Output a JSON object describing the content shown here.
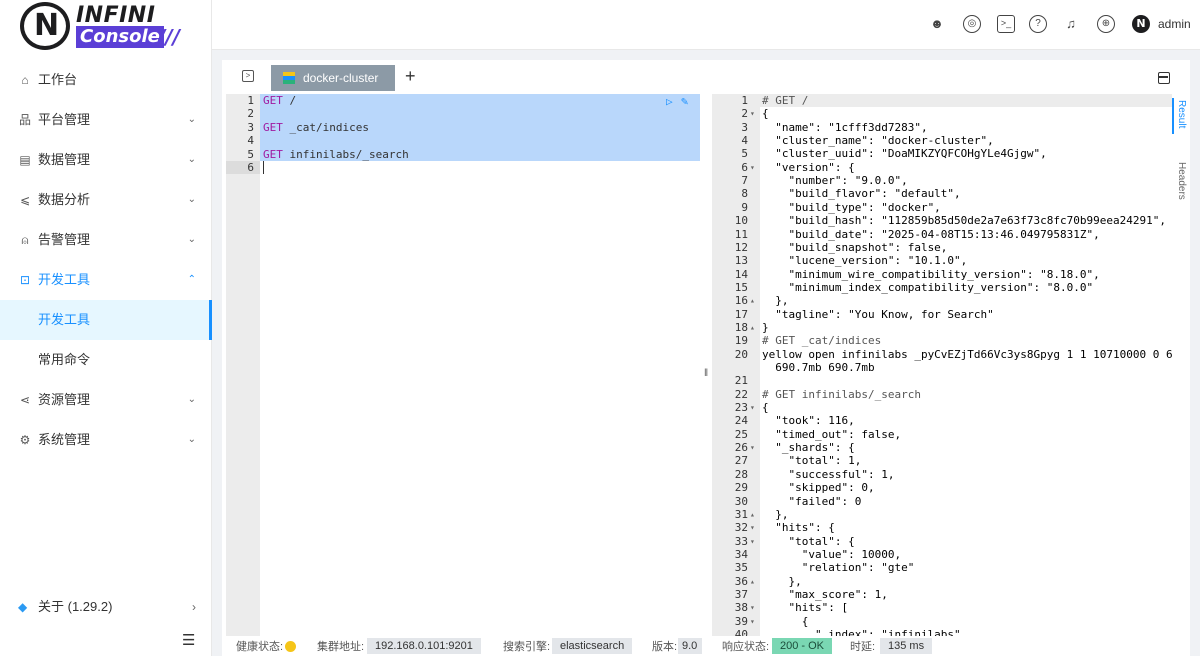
{
  "brand": {
    "mark": "N",
    "name_top": "INFINI",
    "name_bottom": "Console",
    "slashes": "///"
  },
  "colors": {
    "accent": "#1890ff",
    "brand_purple": "#5b3fd6",
    "selection": "#b9d7fb",
    "ok_chip": "#7ad7b3",
    "health_yellow": "#f5c518"
  },
  "sidebar": {
    "items": [
      {
        "label": "工作台",
        "icon": "home-icon"
      },
      {
        "label": "平台管理",
        "icon": "cluster-icon"
      },
      {
        "label": "数据管理",
        "icon": "database-icon"
      },
      {
        "label": "数据分析",
        "icon": "chart-icon"
      },
      {
        "label": "告警管理",
        "icon": "alarm-icon"
      },
      {
        "label": "开发工具",
        "icon": "terminal-icon"
      },
      {
        "label": "开发工具"
      },
      {
        "label": "常用命令"
      },
      {
        "label": "资源管理",
        "icon": "share-icon"
      },
      {
        "label": "系统管理",
        "icon": "gear-icon"
      }
    ],
    "about": "关于 (1.29.2)"
  },
  "topbar": {
    "user": "admin"
  },
  "tabs": [
    {
      "label": "docker-cluster"
    }
  ],
  "editor": {
    "lines": [
      {
        "no": "1",
        "method": "GET",
        "path": " /"
      },
      {
        "no": "2",
        "method": "",
        "path": ""
      },
      {
        "no": "3",
        "method": "GET",
        "path": " _cat/indices"
      },
      {
        "no": "4",
        "method": "",
        "path": ""
      },
      {
        "no": "5",
        "method": "GET",
        "path": " infinilabs/_search"
      },
      {
        "no": "6",
        "method": "",
        "path": ""
      }
    ]
  },
  "output": {
    "lines": [
      {
        "no": "1",
        "text": "# GET /"
      },
      {
        "no": "2",
        "text": "{"
      },
      {
        "no": "3",
        "text": "  \"name\": \"1cfff3dd7283\","
      },
      {
        "no": "4",
        "text": "  \"cluster_name\": \"docker-cluster\","
      },
      {
        "no": "5",
        "text": "  \"cluster_uuid\": \"DoaMIKZYQFCOHgYLe4Gjgw\","
      },
      {
        "no": "6",
        "text": "  \"version\": {"
      },
      {
        "no": "7",
        "text": "    \"number\": \"9.0.0\","
      },
      {
        "no": "8",
        "text": "    \"build_flavor\": \"default\","
      },
      {
        "no": "9",
        "text": "    \"build_type\": \"docker\","
      },
      {
        "no": "10",
        "text": "    \"build_hash\": \"112859b85d50de2a7e63f73c8fc70b99eea24291\","
      },
      {
        "no": "11",
        "text": "    \"build_date\": \"2025-04-08T15:13:46.049795831Z\","
      },
      {
        "no": "12",
        "text": "    \"build_snapshot\": false,"
      },
      {
        "no": "13",
        "text": "    \"lucene_version\": \"10.1.0\","
      },
      {
        "no": "14",
        "text": "    \"minimum_wire_compatibility_version\": \"8.18.0\","
      },
      {
        "no": "15",
        "text": "    \"minimum_index_compatibility_version\": \"8.0.0\""
      },
      {
        "no": "16",
        "text": "  },"
      },
      {
        "no": "17",
        "text": "  \"tagline\": \"You Know, for Search\""
      },
      {
        "no": "18",
        "text": "}"
      },
      {
        "no": "19",
        "text": "# GET _cat/indices"
      },
      {
        "no": "20",
        "text": "yellow open infinilabs _pyCvEZjTd66Vc3ys8Gpyg 1 1 10710000 0 690.7mb"
      },
      {
        "no": "",
        "text": "  690.7mb 690.7mb"
      },
      {
        "no": "21",
        "text": ""
      },
      {
        "no": "22",
        "text": "# GET infinilabs/_search"
      },
      {
        "no": "23",
        "text": "{"
      },
      {
        "no": "24",
        "text": "  \"took\": 116,"
      },
      {
        "no": "25",
        "text": "  \"timed_out\": false,"
      },
      {
        "no": "26",
        "text": "  \"_shards\": {"
      },
      {
        "no": "27",
        "text": "    \"total\": 1,"
      },
      {
        "no": "28",
        "text": "    \"successful\": 1,"
      },
      {
        "no": "29",
        "text": "    \"skipped\": 0,"
      },
      {
        "no": "30",
        "text": "    \"failed\": 0"
      },
      {
        "no": "31",
        "text": "  },"
      },
      {
        "no": "32",
        "text": "  \"hits\": {"
      },
      {
        "no": "33",
        "text": "    \"total\": {"
      },
      {
        "no": "34",
        "text": "      \"value\": 10000,"
      },
      {
        "no": "35",
        "text": "      \"relation\": \"gte\""
      },
      {
        "no": "36",
        "text": "    },"
      },
      {
        "no": "37",
        "text": "    \"max_score\": 1,"
      },
      {
        "no": "38",
        "text": "    \"hits\": ["
      },
      {
        "no": "39",
        "text": "      {"
      },
      {
        "no": "40",
        "text": "        \"_index\": \"infinilabs\""
      }
    ],
    "fold_lines": [
      "2",
      "6",
      "16",
      "18",
      "23",
      "26",
      "31",
      "32",
      "33",
      "36",
      "38",
      "39"
    ]
  },
  "side_tabs": [
    "Result",
    "Headers"
  ],
  "status": {
    "health_label": "健康状态:",
    "cluster_addr_label": "集群地址:",
    "cluster_addr": "192.168.0.101:9201",
    "engine_label": "搜索引擎:",
    "engine": "elasticsearch",
    "version_label": "版本:",
    "version": "9.0",
    "response_label": "响应状态:",
    "response": "200 - OK",
    "time_label": "时延:",
    "time": "135 ms"
  }
}
